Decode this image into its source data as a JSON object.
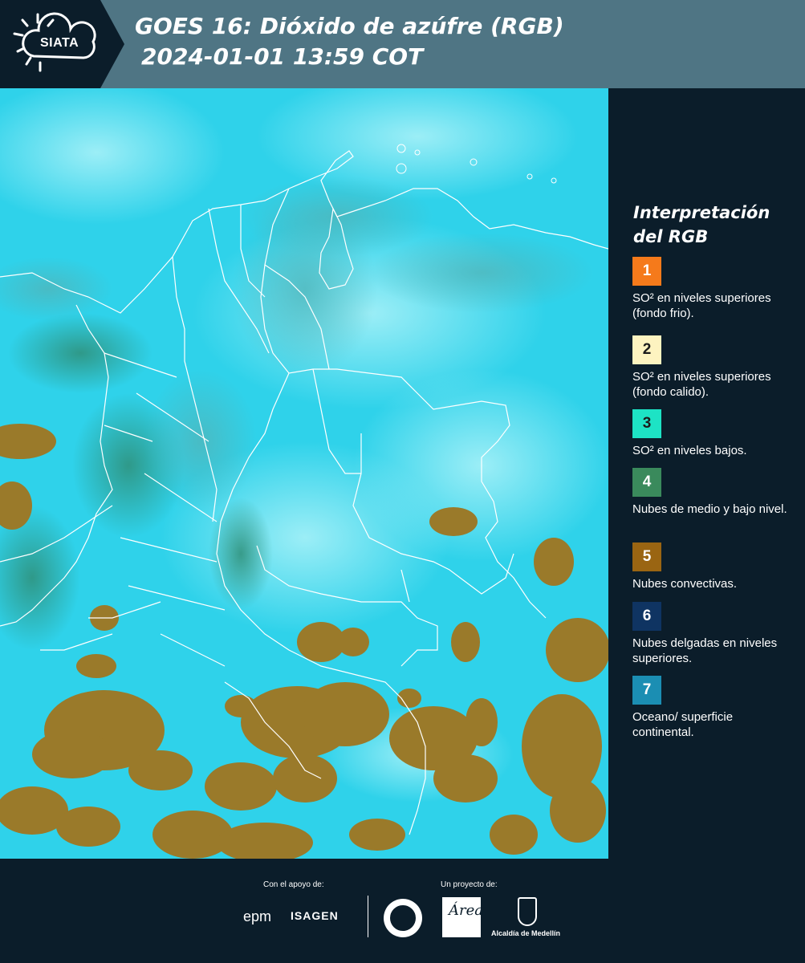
{
  "header": {
    "logo_text": "SIATA",
    "title_line1": "GOES 16: Dióxido de azúfre (RGB)",
    "title_line2": "2024-01-01 13:59 COT"
  },
  "legend": {
    "title": "Interpretación del RGB",
    "items": [
      {
        "number": "1",
        "text": "SO² en niveles superiores (fondo frio).",
        "color": "#f57a1b",
        "number_color": "#ffffff"
      },
      {
        "number": "2",
        "text": "SO² en niveles superiores (fondo calido).",
        "color": "#fdf3c0",
        "number_color": "#1b1b1b"
      },
      {
        "number": "3",
        "text": "SO² en niveles bajos.",
        "color": "#1de3c5",
        "number_color": "#1b1b1b"
      },
      {
        "number": "4",
        "text": "Nubes de medio y bajo nivel.",
        "color": "#3a8a5c",
        "number_color": "#ffffff"
      },
      {
        "number": "5",
        "text": "Nubes convectivas.",
        "color": "#9a6512",
        "number_color": "#ffffff"
      },
      {
        "number": "6",
        "text": "Nubes delgadas en niveles superiores.",
        "color": "#0f3462",
        "number_color": "#ffffff"
      },
      {
        "number": "7",
        "text": "Oceano/ superficie continental.",
        "color": "#1b8eb3",
        "number_color": "#ffffff"
      }
    ]
  },
  "footer": {
    "support_label": "Con el apoyo de:",
    "project_label": "Un proyecto de:",
    "sponsor_1": "epm",
    "sponsor_2": "ISAGEN",
    "partner_area": "Área",
    "partner_alcaldia": "Alcaldía de Medellín"
  },
  "map": {
    "background_color": "#2fd2ea",
    "convective_cloud_color": "#9a7a2a",
    "border_color": "#ffffff"
  }
}
